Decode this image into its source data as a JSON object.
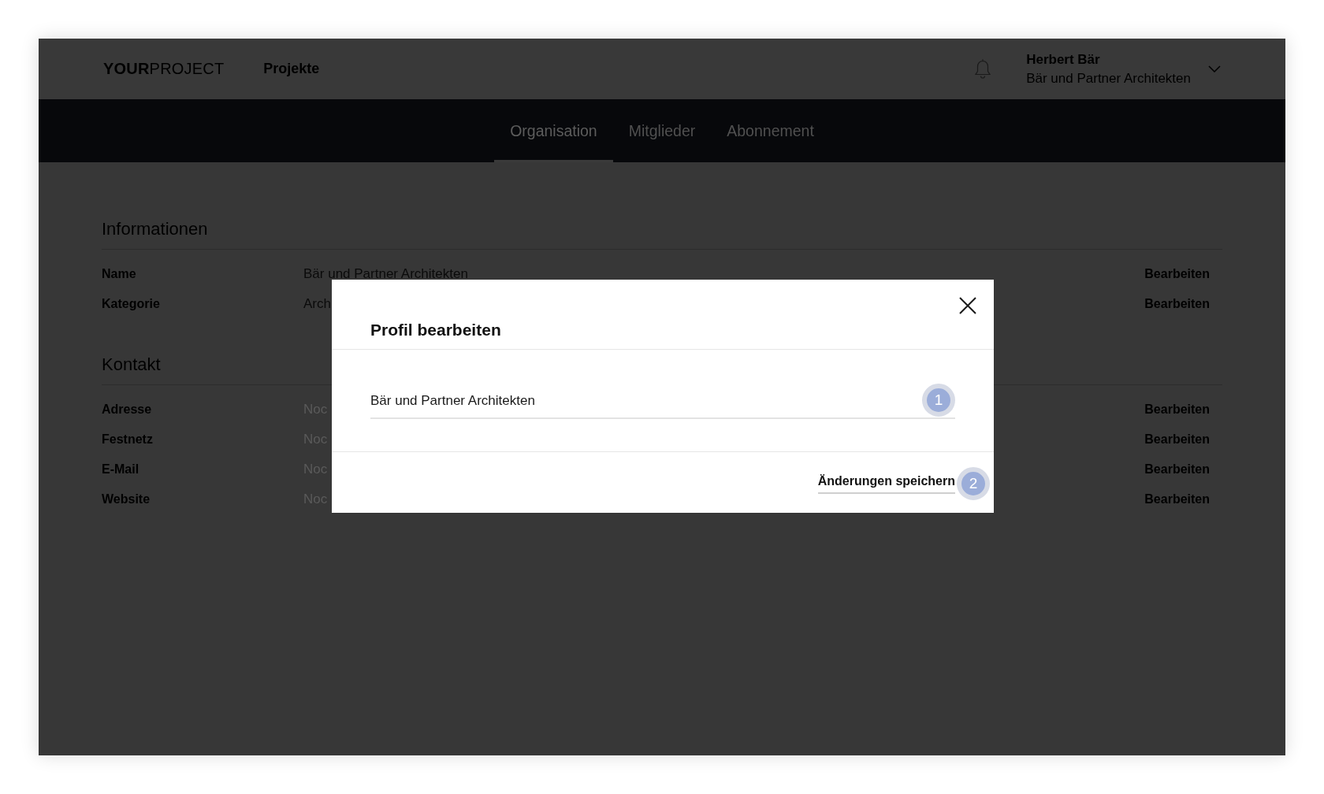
{
  "header": {
    "logo": "**YOUR**PROJECT",
    "nav_link": "Projekte",
    "user": {
      "name": "Herbert Bär",
      "organization": "Bär und Partner Architekten"
    }
  },
  "tabs": [
    {
      "label": "Organisation",
      "selected": true
    },
    {
      "label": "Mitglieder",
      "selected": false
    },
    {
      "label": "Abonnement",
      "selected": false
    }
  ],
  "sections": [
    {
      "title": "Informationen",
      "rows": [
        {
          "label": "Name",
          "value": "Bär und Partner Architekten",
          "empty": false,
          "action": "Bearbeiten"
        },
        {
          "label": "Kategorie",
          "value": "Arch",
          "empty": false,
          "action": "Bearbeiten"
        }
      ]
    },
    {
      "title": "Kontakt",
      "rows": [
        {
          "label": "Adresse",
          "value": "Noc",
          "empty": true,
          "action": "Bearbeiten"
        },
        {
          "label": "Festnetz",
          "value": "Noc",
          "empty": true,
          "action": "Bearbeiten"
        },
        {
          "label": "E-Mail",
          "value": "Noc",
          "empty": true,
          "action": "Bearbeiten"
        },
        {
          "label": "Website",
          "value": "Noc",
          "empty": true,
          "action": "Bearbeiten"
        }
      ]
    }
  ],
  "modal": {
    "title": "Profil bearbeiten",
    "field": {
      "value": "Bär und Partner Architekten",
      "marker": "1"
    },
    "save_button": {
      "label": "Änderungen speichern",
      "marker": "2"
    }
  }
}
